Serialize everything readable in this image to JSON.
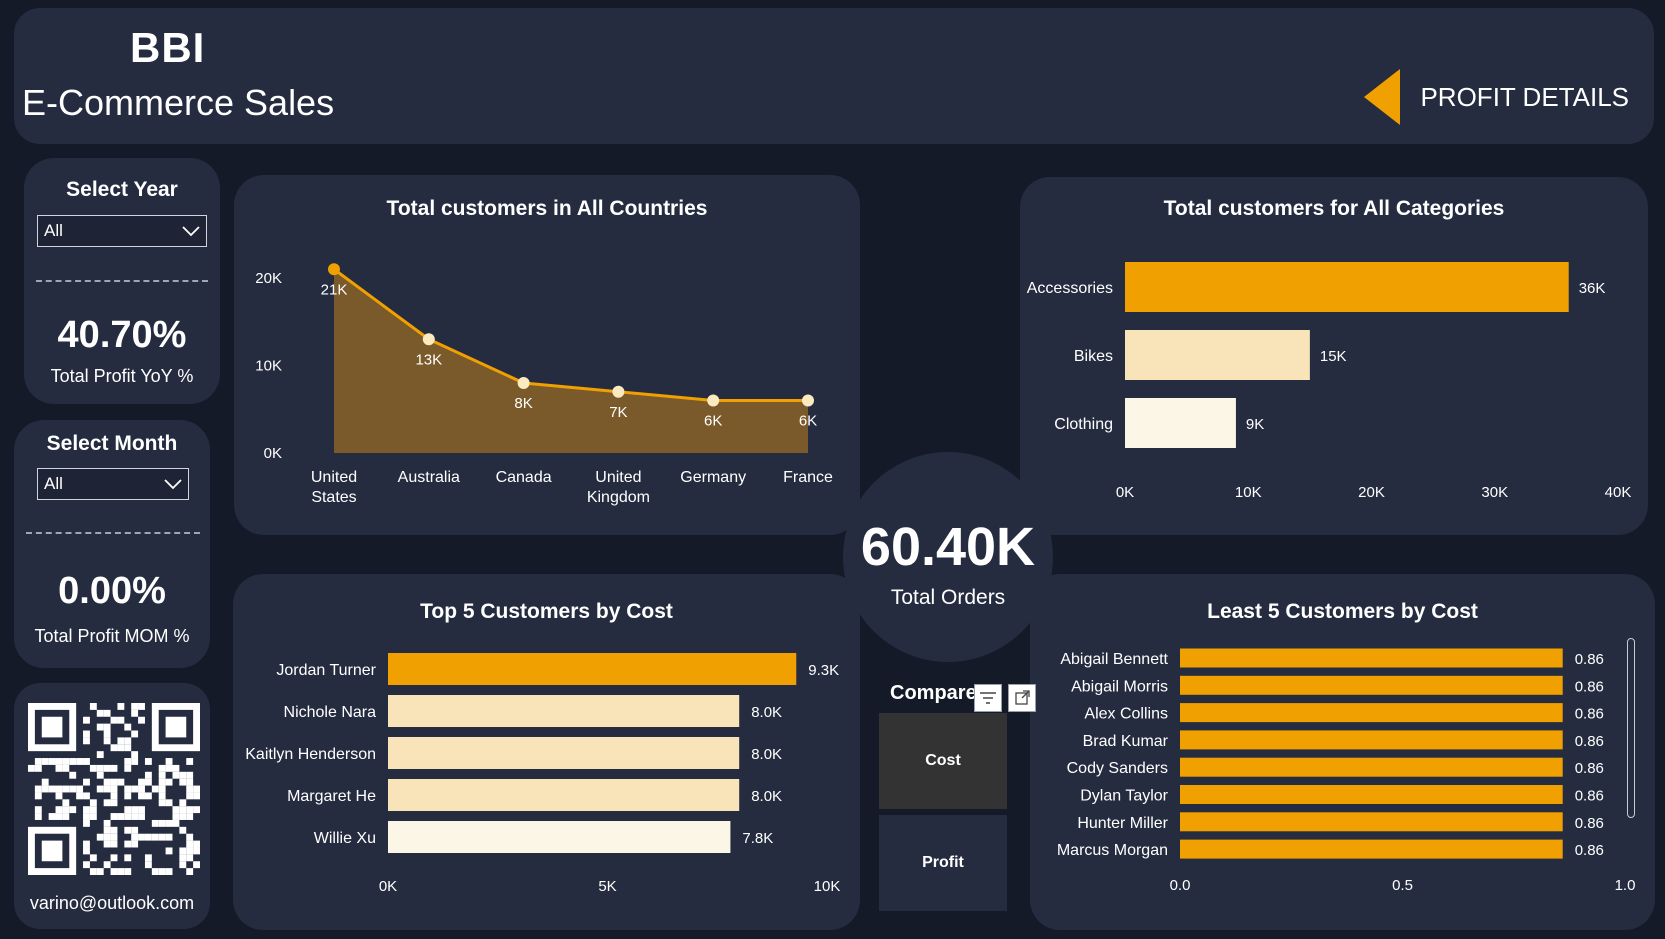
{
  "header": {
    "brand": "BBI",
    "subtitle": "E-Commerce Sales",
    "nav_label": "PROFIT DETAILS"
  },
  "year_slicer": {
    "title": "Select Year",
    "value": "All",
    "kpi_value": "40.70%",
    "kpi_label": "Total Profit YoY %"
  },
  "month_slicer": {
    "title": "Select Month",
    "value": "All",
    "kpi_value": "0.00%",
    "kpi_label": "Total Profit MOM %"
  },
  "contact": {
    "email": "varino@outlook.com"
  },
  "total_orders": {
    "value": "60.40K",
    "label": "Total Orders"
  },
  "compare": {
    "label": "Compare",
    "buttons": [
      "Cost",
      "Profit"
    ]
  },
  "colors": {
    "accent": "#f0a000",
    "light": "#f8e4b8",
    "lighter": "#fcf6e6",
    "card": "#252c40",
    "background": "#141a28"
  },
  "icons": [
    "caret-left-icon",
    "chevron-down-icon",
    "filter-icon",
    "focus-mode-icon",
    "qr-code-icon"
  ],
  "chart_data": [
    {
      "id": "countries",
      "type": "area",
      "title": "Total customers in All Countries",
      "categories": [
        [
          "United",
          "States"
        ],
        [
          "Australia"
        ],
        [
          "Canada"
        ],
        [
          "United",
          "Kingdom"
        ],
        [
          "Germany"
        ],
        [
          "France"
        ]
      ],
      "values": [
        21,
        13,
        8,
        7,
        6,
        6
      ],
      "value_labels": [
        "21K",
        "13K",
        "8K",
        "7K",
        "6K",
        "6K"
      ],
      "yticks": [
        "0K",
        "10K",
        "20K"
      ],
      "ylim": [
        0,
        20
      ],
      "color": "#f0a000"
    },
    {
      "id": "categories",
      "type": "bar",
      "orientation": "horizontal",
      "title": "Total customers for All Categories",
      "categories": [
        "Accessories",
        "Bikes",
        "Clothing"
      ],
      "values": [
        36,
        15,
        9
      ],
      "value_labels": [
        "36K",
        "15K",
        "9K"
      ],
      "xticks": [
        "0K",
        "10K",
        "20K",
        "30K",
        "40K"
      ],
      "xlim": [
        0,
        40
      ]
    },
    {
      "id": "top5",
      "type": "bar",
      "orientation": "horizontal",
      "title": "Top 5 Customers by Cost",
      "categories": [
        "Jordan Turner",
        "Nichole Nara",
        "Kaitlyn Henderson",
        "Margaret He",
        "Willie Xu"
      ],
      "values": [
        9.3,
        8.0,
        8.0,
        8.0,
        7.8
      ],
      "value_labels": [
        "9.3K",
        "8.0K",
        "8.0K",
        "8.0K",
        "7.8K"
      ],
      "xticks": [
        "0K",
        "5K",
        "10K"
      ],
      "xlim": [
        0,
        10
      ]
    },
    {
      "id": "least5",
      "type": "bar",
      "orientation": "horizontal",
      "title": "Least 5 Customers by Cost",
      "categories": [
        "Abigail Bennett",
        "Abigail Morris",
        "Alex Collins",
        "Brad Kumar",
        "Cody Sanders",
        "Dylan Taylor",
        "Hunter Miller",
        "Marcus Morgan"
      ],
      "values": [
        0.86,
        0.86,
        0.86,
        0.86,
        0.86,
        0.86,
        0.86,
        0.86
      ],
      "value_labels": [
        "0.86",
        "0.86",
        "0.86",
        "0.86",
        "0.86",
        "0.86",
        "0.86",
        "0.86"
      ],
      "xticks": [
        "0.0",
        "0.5",
        "1.0"
      ],
      "xlim": [
        0,
        1
      ]
    }
  ]
}
